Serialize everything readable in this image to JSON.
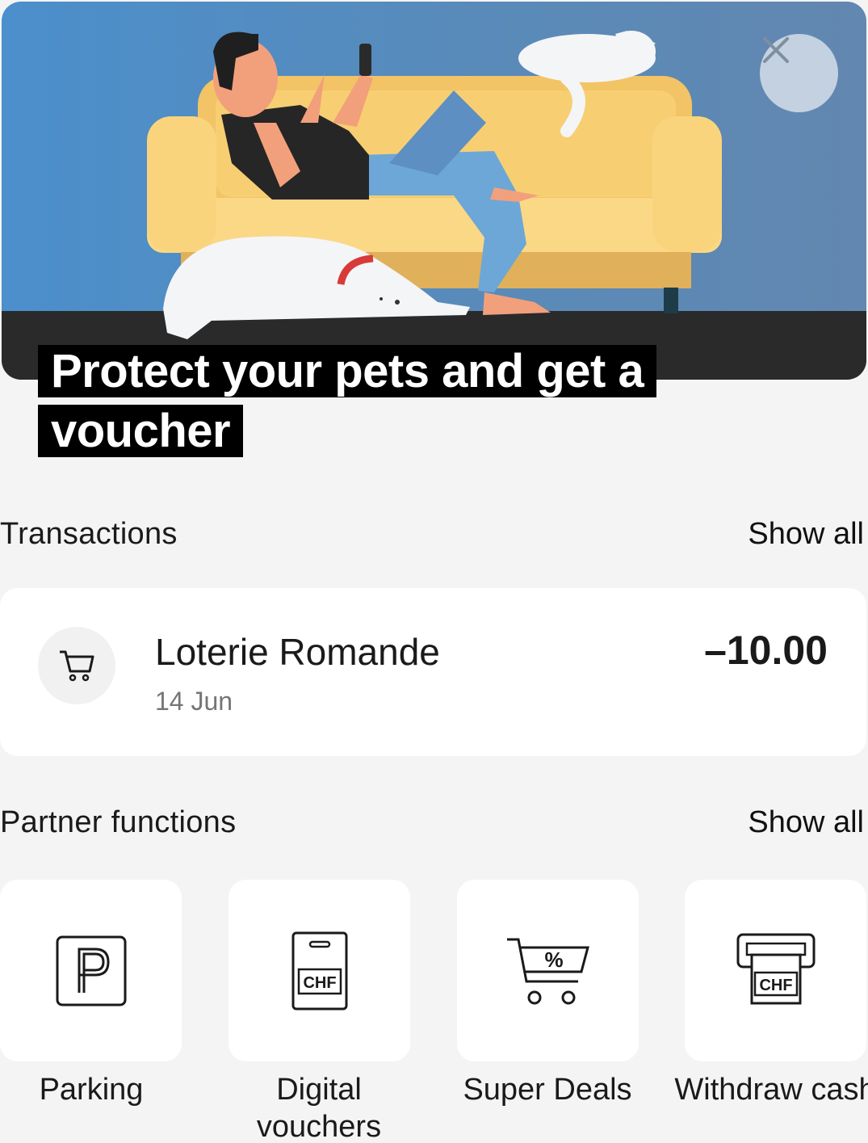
{
  "banner": {
    "title": "Protect your pets and get a voucher",
    "close_icon": "close-icon"
  },
  "transactions": {
    "title": "Transactions",
    "show_all": "Show all",
    "items": [
      {
        "merchant": "Loterie Romande",
        "date": "14 Jun",
        "amount": "–10.00",
        "icon": "cart-icon"
      }
    ]
  },
  "partner_functions": {
    "title": "Partner functions",
    "show_all": "Show all",
    "items": [
      {
        "label": "Parking",
        "icon": "parking-icon"
      },
      {
        "label": "Digital vouchers",
        "icon": "voucher-card-icon"
      },
      {
        "label": "Super Deals",
        "icon": "discount-cart-icon"
      },
      {
        "label": "Withdraw cash",
        "icon": "atm-cash-icon"
      }
    ]
  },
  "colors": {
    "background": "#f4f4f4",
    "card": "#ffffff",
    "banner_sky": "#4b8fcc",
    "sofa": "#f5c96a",
    "title_bg": "#000000"
  }
}
